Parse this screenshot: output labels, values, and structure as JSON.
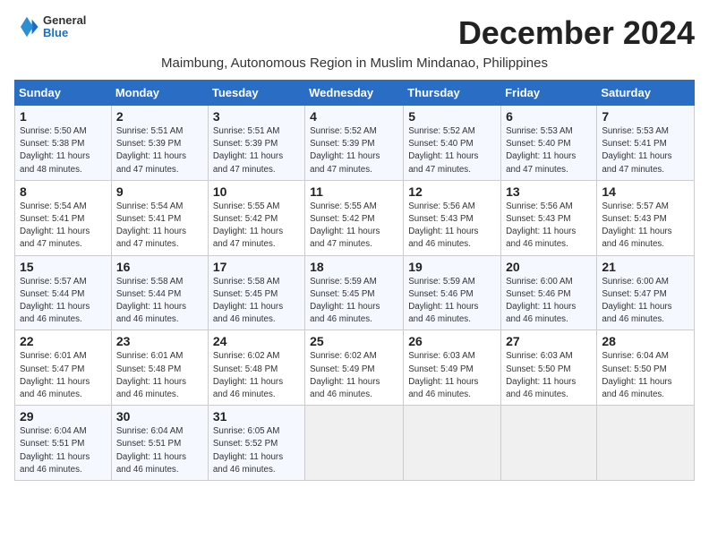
{
  "header": {
    "logo_line1": "General",
    "logo_line2": "Blue",
    "title": "December 2024",
    "subtitle": "Maimbung, Autonomous Region in Muslim Mindanao, Philippines"
  },
  "days_of_week": [
    "Sunday",
    "Monday",
    "Tuesday",
    "Wednesday",
    "Thursday",
    "Friday",
    "Saturday"
  ],
  "weeks": [
    [
      {
        "day": 1,
        "info": "Sunrise: 5:50 AM\nSunset: 5:38 PM\nDaylight: 11 hours\nand 48 minutes."
      },
      {
        "day": 2,
        "info": "Sunrise: 5:51 AM\nSunset: 5:39 PM\nDaylight: 11 hours\nand 47 minutes."
      },
      {
        "day": 3,
        "info": "Sunrise: 5:51 AM\nSunset: 5:39 PM\nDaylight: 11 hours\nand 47 minutes."
      },
      {
        "day": 4,
        "info": "Sunrise: 5:52 AM\nSunset: 5:39 PM\nDaylight: 11 hours\nand 47 minutes."
      },
      {
        "day": 5,
        "info": "Sunrise: 5:52 AM\nSunset: 5:40 PM\nDaylight: 11 hours\nand 47 minutes."
      },
      {
        "day": 6,
        "info": "Sunrise: 5:53 AM\nSunset: 5:40 PM\nDaylight: 11 hours\nand 47 minutes."
      },
      {
        "day": 7,
        "info": "Sunrise: 5:53 AM\nSunset: 5:41 PM\nDaylight: 11 hours\nand 47 minutes."
      }
    ],
    [
      {
        "day": 8,
        "info": "Sunrise: 5:54 AM\nSunset: 5:41 PM\nDaylight: 11 hours\nand 47 minutes."
      },
      {
        "day": 9,
        "info": "Sunrise: 5:54 AM\nSunset: 5:41 PM\nDaylight: 11 hours\nand 47 minutes."
      },
      {
        "day": 10,
        "info": "Sunrise: 5:55 AM\nSunset: 5:42 PM\nDaylight: 11 hours\nand 47 minutes."
      },
      {
        "day": 11,
        "info": "Sunrise: 5:55 AM\nSunset: 5:42 PM\nDaylight: 11 hours\nand 47 minutes."
      },
      {
        "day": 12,
        "info": "Sunrise: 5:56 AM\nSunset: 5:43 PM\nDaylight: 11 hours\nand 46 minutes."
      },
      {
        "day": 13,
        "info": "Sunrise: 5:56 AM\nSunset: 5:43 PM\nDaylight: 11 hours\nand 46 minutes."
      },
      {
        "day": 14,
        "info": "Sunrise: 5:57 AM\nSunset: 5:43 PM\nDaylight: 11 hours\nand 46 minutes."
      }
    ],
    [
      {
        "day": 15,
        "info": "Sunrise: 5:57 AM\nSunset: 5:44 PM\nDaylight: 11 hours\nand 46 minutes."
      },
      {
        "day": 16,
        "info": "Sunrise: 5:58 AM\nSunset: 5:44 PM\nDaylight: 11 hours\nand 46 minutes."
      },
      {
        "day": 17,
        "info": "Sunrise: 5:58 AM\nSunset: 5:45 PM\nDaylight: 11 hours\nand 46 minutes."
      },
      {
        "day": 18,
        "info": "Sunrise: 5:59 AM\nSunset: 5:45 PM\nDaylight: 11 hours\nand 46 minutes."
      },
      {
        "day": 19,
        "info": "Sunrise: 5:59 AM\nSunset: 5:46 PM\nDaylight: 11 hours\nand 46 minutes."
      },
      {
        "day": 20,
        "info": "Sunrise: 6:00 AM\nSunset: 5:46 PM\nDaylight: 11 hours\nand 46 minutes."
      },
      {
        "day": 21,
        "info": "Sunrise: 6:00 AM\nSunset: 5:47 PM\nDaylight: 11 hours\nand 46 minutes."
      }
    ],
    [
      {
        "day": 22,
        "info": "Sunrise: 6:01 AM\nSunset: 5:47 PM\nDaylight: 11 hours\nand 46 minutes."
      },
      {
        "day": 23,
        "info": "Sunrise: 6:01 AM\nSunset: 5:48 PM\nDaylight: 11 hours\nand 46 minutes."
      },
      {
        "day": 24,
        "info": "Sunrise: 6:02 AM\nSunset: 5:48 PM\nDaylight: 11 hours\nand 46 minutes."
      },
      {
        "day": 25,
        "info": "Sunrise: 6:02 AM\nSunset: 5:49 PM\nDaylight: 11 hours\nand 46 minutes."
      },
      {
        "day": 26,
        "info": "Sunrise: 6:03 AM\nSunset: 5:49 PM\nDaylight: 11 hours\nand 46 minutes."
      },
      {
        "day": 27,
        "info": "Sunrise: 6:03 AM\nSunset: 5:50 PM\nDaylight: 11 hours\nand 46 minutes."
      },
      {
        "day": 28,
        "info": "Sunrise: 6:04 AM\nSunset: 5:50 PM\nDaylight: 11 hours\nand 46 minutes."
      }
    ],
    [
      {
        "day": 29,
        "info": "Sunrise: 6:04 AM\nSunset: 5:51 PM\nDaylight: 11 hours\nand 46 minutes."
      },
      {
        "day": 30,
        "info": "Sunrise: 6:04 AM\nSunset: 5:51 PM\nDaylight: 11 hours\nand 46 minutes."
      },
      {
        "day": 31,
        "info": "Sunrise: 6:05 AM\nSunset: 5:52 PM\nDaylight: 11 hours\nand 46 minutes."
      },
      {
        "day": null,
        "info": ""
      },
      {
        "day": null,
        "info": ""
      },
      {
        "day": null,
        "info": ""
      },
      {
        "day": null,
        "info": ""
      }
    ]
  ]
}
